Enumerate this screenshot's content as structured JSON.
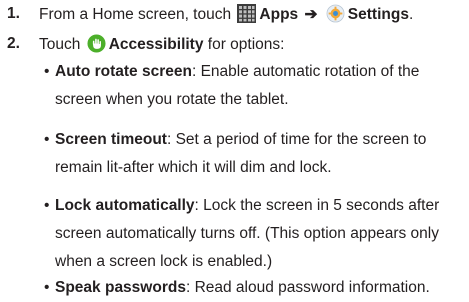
{
  "steps": [
    {
      "number": "1.",
      "text_before": "From a Home screen, touch",
      "icon1": "apps-grid-icon",
      "label1": "Apps",
      "arrow": "➔",
      "icon2": "settings-gear-icon",
      "label2": "Settings",
      "text_after": "."
    },
    {
      "number": "2.",
      "text_before": "Touch",
      "icon1": "accessibility-icon",
      "label1": "Accessibility",
      "text_after": "for options:"
    }
  ],
  "options": [
    {
      "bullet": "•",
      "term": "Auto rotate screen",
      "description": ": Enable automatic rotation of the screen when you rotate the tablet."
    },
    {
      "bullet": "•",
      "term": "Screen timeout",
      "description": ": Set a period of time for the screen to remain lit-after which it will dim and lock."
    },
    {
      "bullet": "•",
      "term": "Lock automatically",
      "description": ": Lock the screen in 5 seconds after screen automatically turns off. (This option appears only when a screen lock is enabled.)"
    },
    {
      "bullet": "•",
      "term": "Speak passwords",
      "description": ": Read aloud password information."
    }
  ],
  "colors": {
    "text": "#231f20",
    "accessibility_green": "#4caf2a",
    "settings_blue": "#3a8fd6",
    "apps_grid": "#5a5a5a"
  }
}
